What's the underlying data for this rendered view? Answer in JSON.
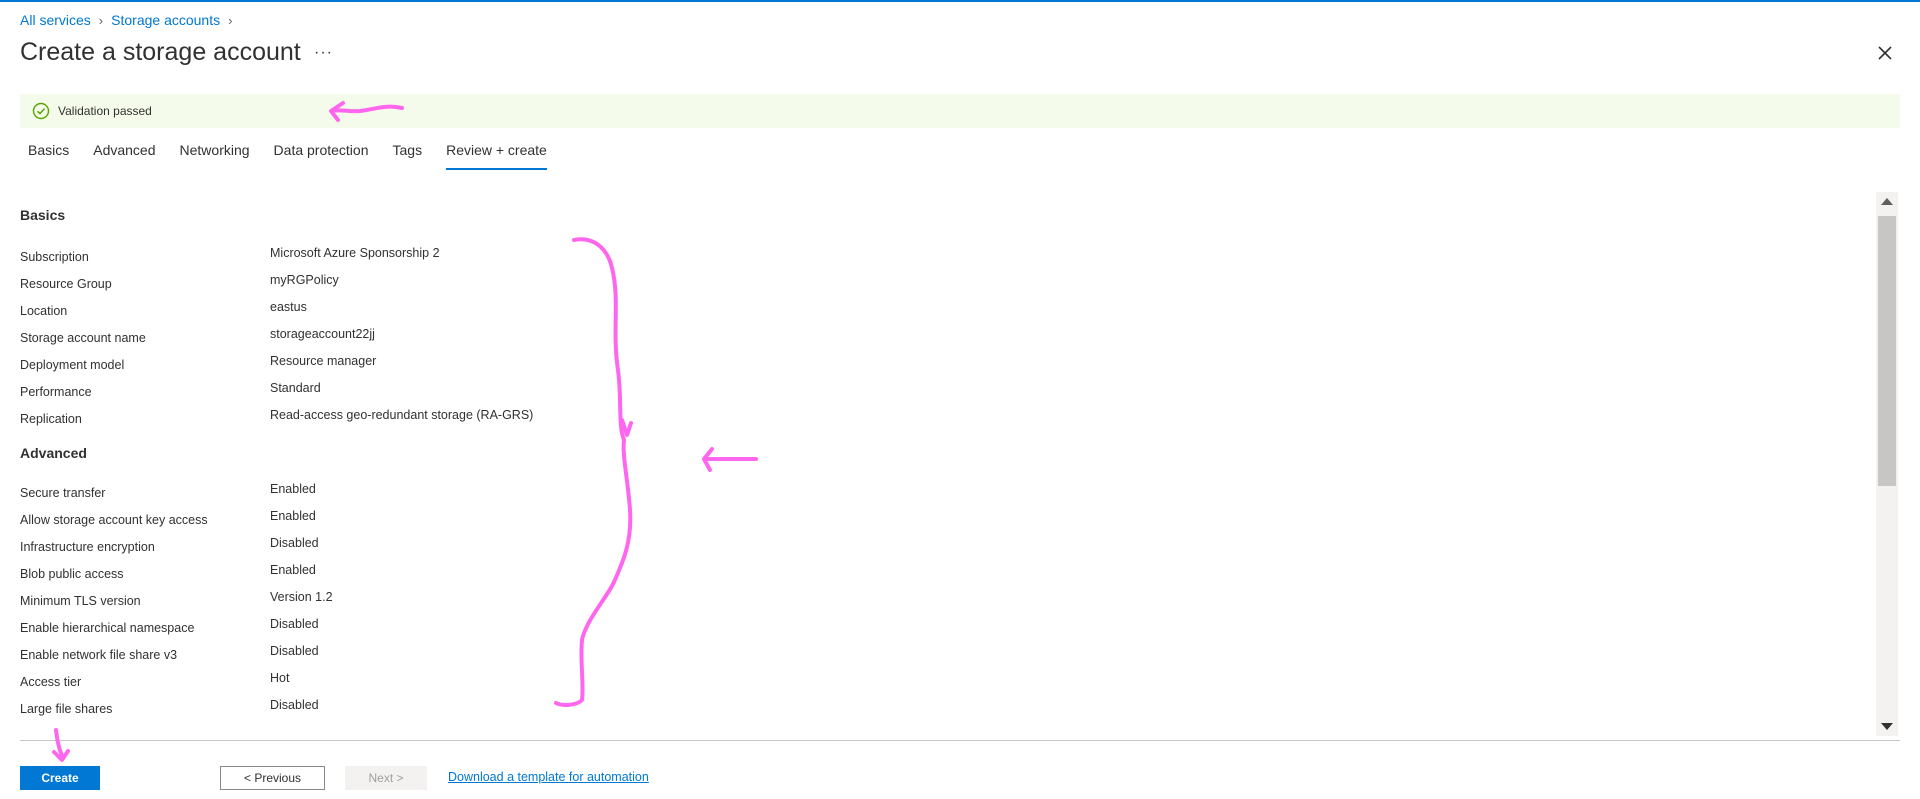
{
  "breadcrumb": {
    "items": [
      "All services",
      "Storage accounts"
    ]
  },
  "page": {
    "title": "Create a storage account",
    "more_label": "···"
  },
  "banner": {
    "text": "Validation passed",
    "color": "#f4fbea",
    "icon": "check-circle-icon"
  },
  "tabs": [
    {
      "label": "Basics",
      "active": false
    },
    {
      "label": "Advanced",
      "active": false
    },
    {
      "label": "Networking",
      "active": false
    },
    {
      "label": "Data protection",
      "active": false
    },
    {
      "label": "Tags",
      "active": false
    },
    {
      "label": "Review + create",
      "active": true
    }
  ],
  "sections": {
    "basics": {
      "title": "Basics",
      "rows": [
        {
          "label": "Subscription",
          "value": "Microsoft Azure Sponsorship 2"
        },
        {
          "label": "Resource Group",
          "value": "myRGPolicy"
        },
        {
          "label": "Location",
          "value": "eastus"
        },
        {
          "label": "Storage account name",
          "value": "storageaccount22jj"
        },
        {
          "label": "Deployment model",
          "value": "Resource manager"
        },
        {
          "label": "Performance",
          "value": "Standard"
        },
        {
          "label": "Replication",
          "value": "Read-access geo-redundant storage (RA-GRS)"
        }
      ]
    },
    "advanced": {
      "title": "Advanced",
      "rows": [
        {
          "label": "Secure transfer",
          "value": "Enabled"
        },
        {
          "label": "Allow storage account key access",
          "value": "Enabled"
        },
        {
          "label": "Infrastructure encryption",
          "value": "Disabled"
        },
        {
          "label": "Blob public access",
          "value": "Enabled"
        },
        {
          "label": "Minimum TLS version",
          "value": "Version 1.2"
        },
        {
          "label": "Enable hierarchical namespace",
          "value": "Disabled"
        },
        {
          "label": "Enable network file share v3",
          "value": "Disabled"
        },
        {
          "label": "Access tier",
          "value": "Hot"
        },
        {
          "label": "Large file shares",
          "value": "Disabled"
        }
      ]
    }
  },
  "footer": {
    "create_label": "Create",
    "previous_label": "< Previous",
    "next_label": "Next >",
    "download_label": "Download a template for automation"
  },
  "colors": {
    "accent": "#0078d4",
    "annotation": "#ff66ee"
  }
}
